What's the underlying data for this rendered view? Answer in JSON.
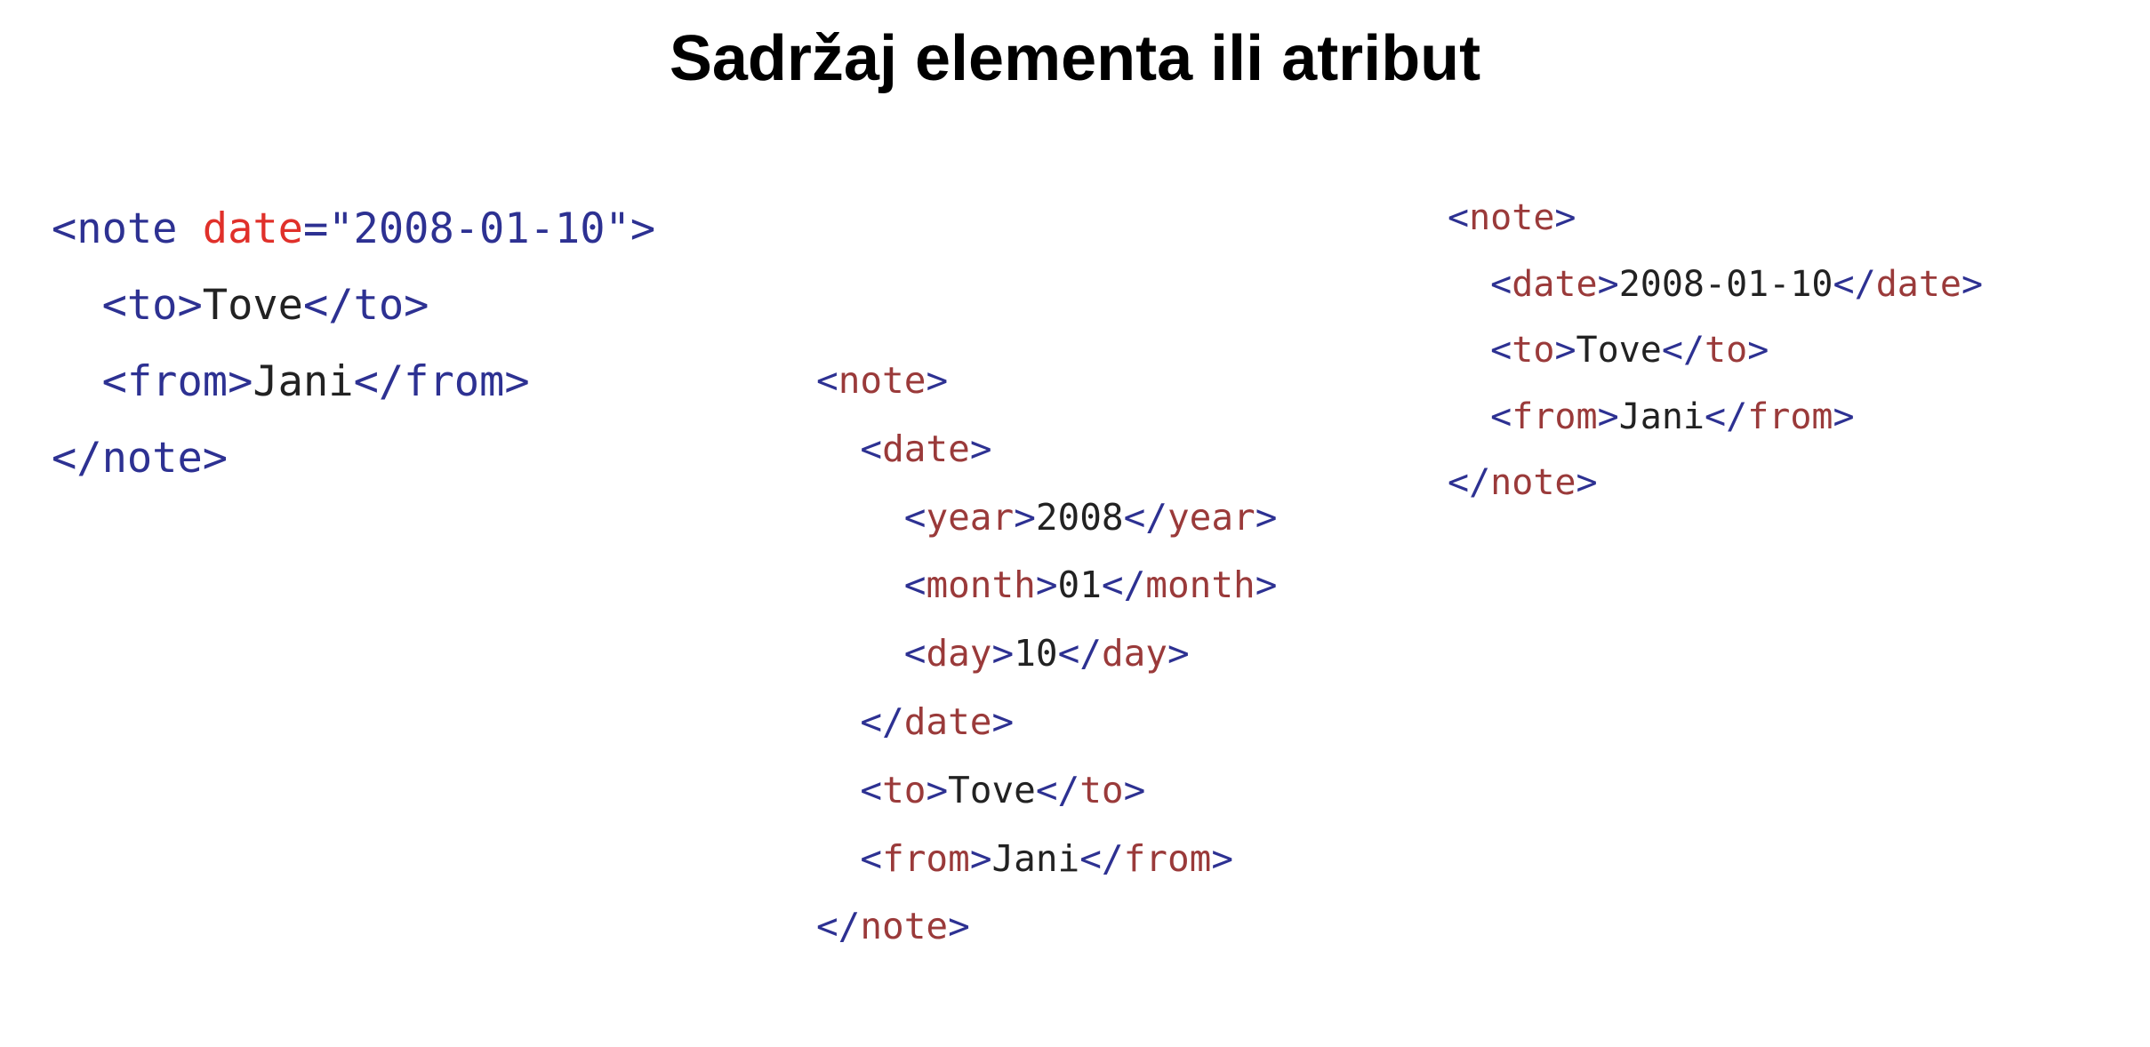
{
  "title": "Sadržaj elementa ili atribut",
  "colors": {
    "tag": "#2d3192",
    "tag_name": "#9a3a3a",
    "attribute_name": "#e0302a",
    "attribute_value": "#2d3192",
    "text": "#222222",
    "background": "#ffffff"
  },
  "code_blocks": [
    {
      "lines": [
        [
          {
            "text": "<",
            "kind": "tag"
          },
          {
            "text": "note",
            "kind": "tag"
          },
          {
            "text": " ",
            "kind": "text"
          },
          {
            "text": "date",
            "kind": "attribute_name"
          },
          {
            "text": "=\"2008-01-10\">",
            "kind": "attribute_value"
          }
        ],
        [
          {
            "text": "  ",
            "kind": "text"
          },
          {
            "text": "<",
            "kind": "tag"
          },
          {
            "text": "to",
            "kind": "tag"
          },
          {
            "text": ">",
            "kind": "tag"
          },
          {
            "text": "Tove",
            "kind": "text"
          },
          {
            "text": "</",
            "kind": "tag"
          },
          {
            "text": "to",
            "kind": "tag"
          },
          {
            "text": ">",
            "kind": "tag"
          }
        ],
        [
          {
            "text": "  ",
            "kind": "text"
          },
          {
            "text": "<",
            "kind": "tag"
          },
          {
            "text": "from",
            "kind": "tag"
          },
          {
            "text": ">",
            "kind": "tag"
          },
          {
            "text": "Jani",
            "kind": "text"
          },
          {
            "text": "</",
            "kind": "tag"
          },
          {
            "text": "from",
            "kind": "tag"
          },
          {
            "text": ">",
            "kind": "tag"
          }
        ],
        [
          {
            "text": "</",
            "kind": "tag"
          },
          {
            "text": "note",
            "kind": "tag"
          },
          {
            "text": ">",
            "kind": "tag"
          }
        ]
      ]
    },
    {
      "lines": [
        [
          {
            "text": "<",
            "kind": "tag"
          },
          {
            "text": "note",
            "kind": "tag_name"
          },
          {
            "text": ">",
            "kind": "tag"
          }
        ],
        [
          {
            "text": "  ",
            "kind": "text"
          },
          {
            "text": "<",
            "kind": "tag"
          },
          {
            "text": "date",
            "kind": "tag_name"
          },
          {
            "text": ">",
            "kind": "tag"
          }
        ],
        [
          {
            "text": "    ",
            "kind": "text"
          },
          {
            "text": "<",
            "kind": "tag"
          },
          {
            "text": "year",
            "kind": "tag_name"
          },
          {
            "text": ">",
            "kind": "tag"
          },
          {
            "text": "2008",
            "kind": "text"
          },
          {
            "text": "</",
            "kind": "tag"
          },
          {
            "text": "year",
            "kind": "tag_name"
          },
          {
            "text": ">",
            "kind": "tag"
          }
        ],
        [
          {
            "text": "    ",
            "kind": "text"
          },
          {
            "text": "<",
            "kind": "tag"
          },
          {
            "text": "month",
            "kind": "tag_name"
          },
          {
            "text": ">",
            "kind": "tag"
          },
          {
            "text": "01",
            "kind": "text"
          },
          {
            "text": "</",
            "kind": "tag"
          },
          {
            "text": "month",
            "kind": "tag_name"
          },
          {
            "text": ">",
            "kind": "tag"
          }
        ],
        [
          {
            "text": "    ",
            "kind": "text"
          },
          {
            "text": "<",
            "kind": "tag"
          },
          {
            "text": "day",
            "kind": "tag_name"
          },
          {
            "text": ">",
            "kind": "tag"
          },
          {
            "text": "10",
            "kind": "text"
          },
          {
            "text": "</",
            "kind": "tag"
          },
          {
            "text": "day",
            "kind": "tag_name"
          },
          {
            "text": ">",
            "kind": "tag"
          }
        ],
        [
          {
            "text": "  ",
            "kind": "text"
          },
          {
            "text": "</",
            "kind": "tag"
          },
          {
            "text": "date",
            "kind": "tag_name"
          },
          {
            "text": ">",
            "kind": "tag"
          }
        ],
        [
          {
            "text": "  ",
            "kind": "text"
          },
          {
            "text": "<",
            "kind": "tag"
          },
          {
            "text": "to",
            "kind": "tag_name"
          },
          {
            "text": ">",
            "kind": "tag"
          },
          {
            "text": "Tove",
            "kind": "text"
          },
          {
            "text": "</",
            "kind": "tag"
          },
          {
            "text": "to",
            "kind": "tag_name"
          },
          {
            "text": ">",
            "kind": "tag"
          }
        ],
        [
          {
            "text": "  ",
            "kind": "text"
          },
          {
            "text": "<",
            "kind": "tag"
          },
          {
            "text": "from",
            "kind": "tag_name"
          },
          {
            "text": ">",
            "kind": "tag"
          },
          {
            "text": "Jani",
            "kind": "text"
          },
          {
            "text": "</",
            "kind": "tag"
          },
          {
            "text": "from",
            "kind": "tag_name"
          },
          {
            "text": ">",
            "kind": "tag"
          }
        ],
        [
          {
            "text": "</",
            "kind": "tag"
          },
          {
            "text": "note",
            "kind": "tag_name"
          },
          {
            "text": ">",
            "kind": "tag"
          }
        ]
      ]
    },
    {
      "lines": [
        [
          {
            "text": "<",
            "kind": "tag"
          },
          {
            "text": "note",
            "kind": "tag_name"
          },
          {
            "text": ">",
            "kind": "tag"
          }
        ],
        [
          {
            "text": "  ",
            "kind": "text"
          },
          {
            "text": "<",
            "kind": "tag"
          },
          {
            "text": "date",
            "kind": "tag_name"
          },
          {
            "text": ">",
            "kind": "tag"
          },
          {
            "text": "2008-01-10",
            "kind": "text"
          },
          {
            "text": "</",
            "kind": "tag"
          },
          {
            "text": "date",
            "kind": "tag_name"
          },
          {
            "text": ">",
            "kind": "tag"
          }
        ],
        [
          {
            "text": "  ",
            "kind": "text"
          },
          {
            "text": "<",
            "kind": "tag"
          },
          {
            "text": "to",
            "kind": "tag_name"
          },
          {
            "text": ">",
            "kind": "tag"
          },
          {
            "text": "Tove",
            "kind": "text"
          },
          {
            "text": "</",
            "kind": "tag"
          },
          {
            "text": "to",
            "kind": "tag_name"
          },
          {
            "text": ">",
            "kind": "tag"
          }
        ],
        [
          {
            "text": "  ",
            "kind": "text"
          },
          {
            "text": "<",
            "kind": "tag"
          },
          {
            "text": "from",
            "kind": "tag_name"
          },
          {
            "text": ">",
            "kind": "tag"
          },
          {
            "text": "Jani",
            "kind": "text"
          },
          {
            "text": "</",
            "kind": "tag"
          },
          {
            "text": "from",
            "kind": "tag_name"
          },
          {
            "text": ">",
            "kind": "tag"
          }
        ],
        [
          {
            "text": "</",
            "kind": "tag"
          },
          {
            "text": "note",
            "kind": "tag_name"
          },
          {
            "text": ">",
            "kind": "tag"
          }
        ]
      ]
    }
  ]
}
